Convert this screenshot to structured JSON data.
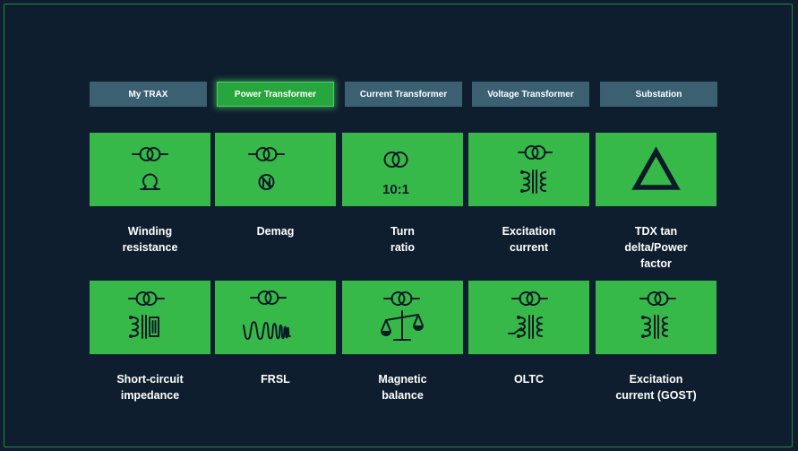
{
  "tabs": [
    {
      "label": "My TRAX",
      "active": false
    },
    {
      "label": "Power Transformer",
      "active": true
    },
    {
      "label": "Current Transformer",
      "active": false
    },
    {
      "label": "Voltage Transformer",
      "active": false
    },
    {
      "label": "Substation",
      "active": false
    }
  ],
  "tiles": [
    {
      "label": "Winding\nresistance",
      "icon": "winding-resistance-icon"
    },
    {
      "label": "Demag",
      "icon": "demag-icon"
    },
    {
      "label": "Turn\nratio",
      "icon": "turn-ratio-icon",
      "icon_text": "10:1"
    },
    {
      "label": "Excitation\ncurrent",
      "icon": "excitation-current-icon"
    },
    {
      "label": "TDX tan\ndelta/Power\nfactor",
      "icon": "delta-triangle-icon"
    },
    {
      "label": "Short-circuit\nimpedance",
      "icon": "short-circuit-impedance-icon"
    },
    {
      "label": "FRSL",
      "icon": "frsl-icon"
    },
    {
      "label": "Magnetic\nbalance",
      "icon": "magnetic-balance-icon"
    },
    {
      "label": "OLTC",
      "icon": "oltc-icon"
    },
    {
      "label": "Excitation\ncurrent (GOST)",
      "icon": "excitation-current-gost-icon"
    }
  ],
  "colors": {
    "background": "#0f1e2e",
    "tab": "#3a6072",
    "tab_active": "#26a63c",
    "tile": "#37b94a",
    "icon": "#0d1a28",
    "text": "#ffffff"
  }
}
